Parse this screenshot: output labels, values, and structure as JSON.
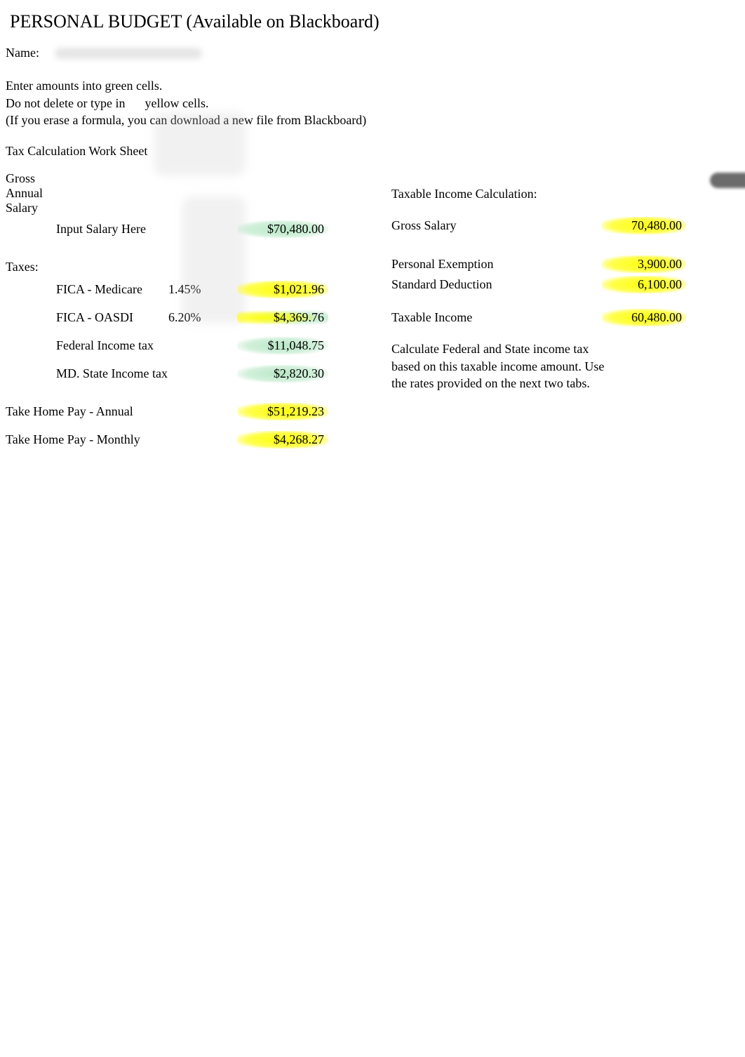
{
  "title": "PERSONAL BUDGET (Available on Blackboard)",
  "name_label": "Name:",
  "instructions": {
    "line1": "Enter amounts into green cells.",
    "line2a": "Do not delete or type in",
    "line2b": "yellow cells.",
    "line3": "(If you erase a formula, you can download a new file from Blackboard)"
  },
  "section_heading": "Tax Calculation Work Sheet",
  "left": {
    "gross_label": "Gross Annual Salary",
    "input_here": "Input Salary Here",
    "salary": "$70,480.00",
    "taxes_label": "Taxes:",
    "fica_medicare_label": "FICA - Medicare",
    "fica_medicare_rate": "1.45%",
    "fica_medicare_val": "$1,021.96",
    "fica_oasdi_label": "FICA - OASDI",
    "fica_oasdi_rate": "6.20%",
    "fica_oasdi_val": "$4,369.76",
    "fed_label": "Federal Income tax",
    "fed_val": "$11,048.75",
    "md_label": "MD. State Income tax",
    "md_val": "$2,820.30",
    "takehome_annual_label": "Take Home Pay - Annual",
    "takehome_annual_val": "$51,219.23",
    "takehome_monthly_label": "Take Home Pay - Monthly",
    "takehome_monthly_val": "$4,268.27"
  },
  "right": {
    "heading": "Taxable Income Calculation:",
    "gross_label": "Gross Salary",
    "gross_val": "70,480.00",
    "pe_label": "Personal Exemption",
    "pe_val": "3,900.00",
    "sd_label": "Standard Deduction",
    "sd_val": "6,100.00",
    "ti_label": "Taxable Income",
    "ti_val": "60,480.00",
    "note": "Calculate Federal and State income tax based on this taxable income amount. Use the rates provided on the next two tabs."
  }
}
